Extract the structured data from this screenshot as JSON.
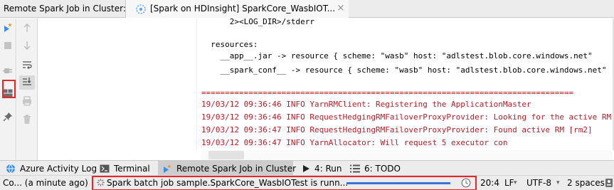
{
  "tabs": {
    "tool_window_title": "Remote Spark Job in Cluster:",
    "job_tab_label": "[Spark on HDInsight] SparkCore_WasbIOT...",
    "job_tab_close": "×"
  },
  "left_actions": [
    {
      "name": "run-spark-job",
      "icon": "spark-run-icon"
    },
    {
      "name": "stop",
      "icon": "stop-icon"
    },
    {
      "name": "disconnect",
      "icon": "plug-disconnect-icon"
    },
    {
      "name": "layout",
      "icon": "layout-icon"
    },
    {
      "name": "pin",
      "icon": "pin-icon"
    }
  ],
  "toolbar_actions": [
    {
      "name": "scroll-up",
      "icon": "arrow-up-icon"
    },
    {
      "name": "scroll-down",
      "icon": "arrow-down-icon"
    },
    {
      "name": "soft-wrap",
      "icon": "soft-wrap-icon"
    },
    {
      "name": "scroll-to-end",
      "icon": "scroll-to-end-icon"
    },
    {
      "name": "print",
      "icon": "print-icon"
    },
    {
      "name": "clear",
      "icon": "trash-icon"
    }
  ],
  "console": {
    "lines": [
      {
        "text": "      2><LOG_DIR>/stderr",
        "color": "black"
      },
      {
        "text": "",
        "color": "black"
      },
      {
        "text": "  resources:",
        "color": "black"
      },
      {
        "text": "    __app__.jar -> resource { scheme: \"wasb\" host: \"adlstest.blob.core.windows.net\"",
        "color": "black"
      },
      {
        "text": "    __spark_conf__ -> resource { scheme: \"wasb\" host: \"adlstest.blob.core.windows.net\"",
        "color": "black"
      },
      {
        "text": "",
        "color": "black"
      },
      {
        "text": "===============================================================================",
        "color": "red"
      },
      {
        "text": "19/03/12 09:36:46 INFO YarnRMClient: Registering the ApplicationMaster",
        "color": "red"
      },
      {
        "text": "19/03/12 09:36:46 INFO RequestHedgingRMFailoverProxyProvider: Looking for the active RM",
        "color": "red"
      },
      {
        "text": "19/03/12 09:36:47 INFO RequestHedgingRMFailoverProxyProvider: Found active RM [rm2]",
        "color": "red"
      },
      {
        "text": "19/03/12 09:36:47 INFO YarnAllocator: Will request 5 executor con",
        "color": "red"
      }
    ]
  },
  "tool_windows": {
    "azure_activity_log": "Azure Activity Log",
    "terminal": "Terminal",
    "remote_spark_job": "Remote Spark Job in Cluster",
    "run": "4: Run",
    "todo": "6: TODO"
  },
  "status": {
    "left_text": "Co... (a minute ago)",
    "task_text": "Spark batch job sample.SparkCore_WasbIOTest is runn...",
    "progress_fraction": 1.0,
    "position": "20:4",
    "line_separator": "LF",
    "encoding": "UTF-8",
    "indent": "2 spaces"
  },
  "colors": {
    "highlight_box": "#e8262a",
    "log_red": "#b0202b",
    "progress": "#3b72d9"
  }
}
